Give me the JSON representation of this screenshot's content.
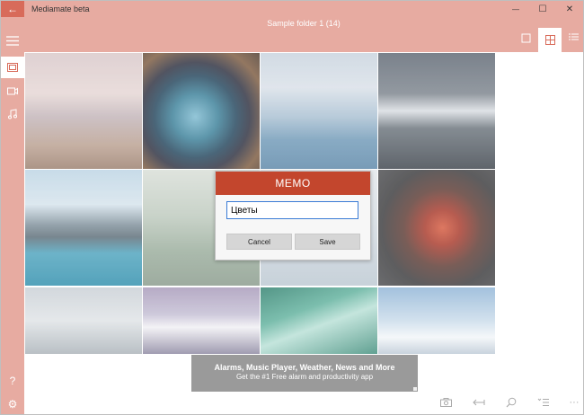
{
  "window": {
    "title": "Mediamate beta",
    "back_glyph": "←",
    "minimize_glyph": "—",
    "maximize_glyph": "☐",
    "close_glyph": "✕"
  },
  "header": {
    "folder_title": "Sample folder 1  (14)"
  },
  "icons": {
    "menu": "hamburger-icon",
    "photos": "photos-icon",
    "video": "video-icon",
    "music": "music-icon",
    "help": "help-icon",
    "settings": "gear-icon",
    "view_single": "square-icon",
    "view_grid": "grid-icon",
    "view_list": "list-icon",
    "camera": "camera-icon",
    "fit": "fit-width-icon",
    "search": "search-icon",
    "sort": "sort-list-icon",
    "more": "more-icon"
  },
  "sidebar": {
    "help_glyph": "?",
    "settings_glyph": "⚙"
  },
  "dialog": {
    "title": "MEMO",
    "input_value": "Цветы",
    "cancel_label": "Cancel",
    "save_label": "Save"
  },
  "ad": {
    "title": "Alarms, Music Player, Weather, News and More",
    "subtitle": "Get the #1 Free alarm and productivity app"
  },
  "toolbar": {
    "more_glyph": "···"
  },
  "colors": {
    "accent": "#e7aba1",
    "accent_dark": "#d86b5a",
    "dialog_header": "#c3462d",
    "ad_background": "#9a9a9a"
  }
}
